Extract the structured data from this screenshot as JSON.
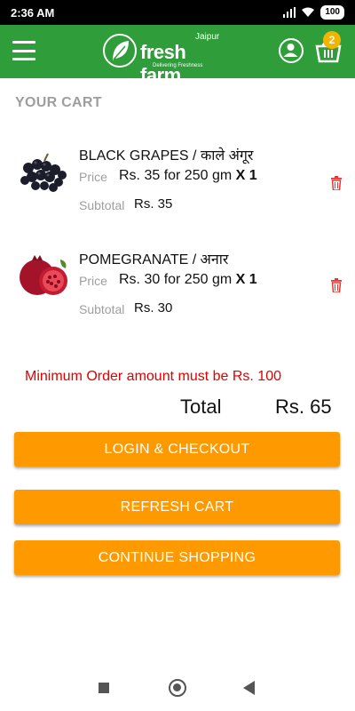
{
  "status_bar": {
    "time": "2:36 AM",
    "battery": "100"
  },
  "app_bar": {
    "menu_icon": "hamburger-menu-icon",
    "logo": {
      "city": "Jaipur",
      "name": "fresh farm",
      "tagline": "Delivering Freshness"
    },
    "account_icon": "user-circle-icon",
    "cart_icon": "basket-icon",
    "cart_count": "2"
  },
  "cart": {
    "title": "YOUR CART",
    "price_label": "Price",
    "subtotal_label": "Subtotal",
    "items": [
      {
        "name": "BLACK GRAPES / काले अंगूर",
        "price": "Rs. 35 for 250 gm",
        "qty": "X 1",
        "subtotal": "Rs. 35",
        "image": "black-grapes"
      },
      {
        "name": "POMEGRANATE / अनार",
        "price": "Rs. 30 for 250 gm",
        "qty": "X 1",
        "subtotal": "Rs. 30",
        "image": "pomegranate"
      }
    ],
    "min_order_notice": "Minimum Order amount must be Rs. 100",
    "total_label": "Total",
    "total_value": "Rs. 65"
  },
  "buttons": {
    "login_checkout": "LOGIN & CHECKOUT",
    "refresh_cart": "REFRESH CART",
    "continue_shopping": "CONTINUE SHOPPING"
  },
  "colors": {
    "primary": "#2e9d3a",
    "accent": "#ff9900",
    "badge": "#f3b400",
    "error": "#e00000"
  }
}
